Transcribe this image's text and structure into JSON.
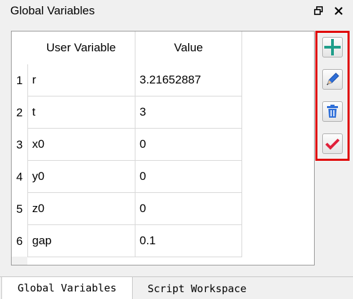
{
  "panel": {
    "title": "Global Variables"
  },
  "table": {
    "columns": [
      "User Variable",
      "Value"
    ],
    "rows": [
      {
        "num": "1",
        "variable": "r",
        "value": "3.21652887"
      },
      {
        "num": "2",
        "variable": "t",
        "value": "3"
      },
      {
        "num": "3",
        "variable": "x0",
        "value": "0"
      },
      {
        "num": "4",
        "variable": "y0",
        "value": "0"
      },
      {
        "num": "5",
        "variable": "z0",
        "value": "0"
      },
      {
        "num": "6",
        "variable": "gap",
        "value": "0.1"
      }
    ]
  },
  "toolbar": {
    "icons": [
      "plus-icon",
      "pencil-icon",
      "trash-icon",
      "checkmark-icon"
    ],
    "accent": "#e00000"
  },
  "tabs": [
    {
      "label": "Global Variables",
      "active": true
    },
    {
      "label": "Script Workspace",
      "active": false
    }
  ]
}
